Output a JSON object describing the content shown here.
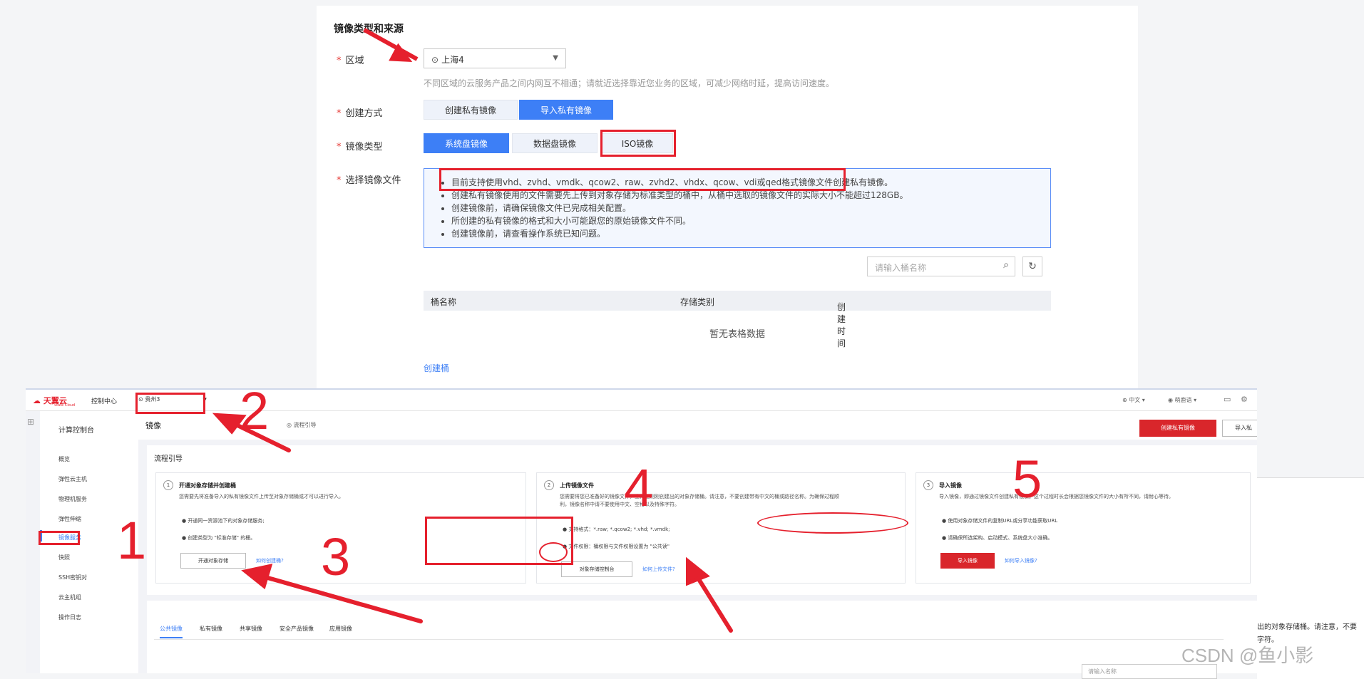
{
  "form": {
    "section_title": "镜像类型和来源",
    "region_label": "区域",
    "region_value": "上海4",
    "region_hint": "不同区域的云服务产品之间内网互不相通；请就近选择靠近您业务的区域，可减少网络时延，提高访问速度。",
    "create_method_label": "创建方式",
    "create_method_options": [
      "创建私有镜像",
      "导入私有镜像"
    ],
    "create_method_selected": "导入私有镜像",
    "image_type_label": "镜像类型",
    "image_type_options": [
      "系统盘镜像",
      "数据盘镜像",
      "ISO镜像"
    ],
    "image_type_selected": "系统盘镜像",
    "file_label": "选择镜像文件",
    "notes": [
      "目前支持使用vhd、zvhd、vmdk、qcow2、raw、zvhd2、vhdx、qcow、vdi或qed格式镜像文件创建私有镜像。",
      "创建私有镜像使用的文件需要先上传到对象存储为标准类型的桶中，从桶中选取的镜像文件的实际大小不能超过128GB。",
      "创建镜像前，请确保镜像文件已完成相关配置。",
      "所创建的私有镜像的格式和大小可能跟您的原始镜像文件不同。",
      "创建镜像前，请查看操作系统已知问题。"
    ],
    "bucket_search_placeholder": "请输入桶名称",
    "table_columns": [
      "桶名称",
      "存储类别",
      "创建时间"
    ],
    "table_empty": "暂无表格数据",
    "create_bucket_link": "创建桶"
  },
  "console": {
    "logo": "天翼云",
    "logo_sub": "State Cloud",
    "control_center": "控制中心",
    "region": "贵州3",
    "language": "中文",
    "user": "萌鹿语",
    "sidebar_head": "计算控制台",
    "sidebar_items": [
      "概览",
      "弹性云主机",
      "物理机服务",
      "弹性伸缩",
      "镜像服务",
      "快照",
      "SSH密钥对",
      "云主机组",
      "操作日志"
    ],
    "sidebar_active": "镜像服务",
    "page_title": "镜像",
    "guide_link": "流程引导",
    "btn_create_private": "创建私有镜像",
    "btn_import": "导入私",
    "flow_title": "流程引导",
    "cards": [
      {
        "num": "1",
        "title": "开通对象存储并创建桶",
        "desc": "您需要先将准备导入的私有镜像文件上传至对象存储桶或才可以进行导入。",
        "bullets": [
          "开通同一资源池下的对象存储服务;",
          "创建类型为 \"标准存储\" 的桶。"
        ],
        "button": "开通对象存储",
        "link": "如何创建桶?"
      },
      {
        "num": "2",
        "title": "上传镜像文件",
        "desc": "您需要将您已准备好的镜像文件，上传至刚刚创建出的对象存储桶。请注意，不要创建带有中文的桶或路径名称。为确保过程顺利，镜像名称中请不要使用中文、空格以及特殊字符。",
        "bullets": [
          "支持格式：*.raw; *.qcow2; *.vhd; *.vmdk;",
          "文件权限：桶权限与文件权限设置为 \"公共读\""
        ],
        "button": "对象存储控制台",
        "link": "如何上传文件?"
      },
      {
        "num": "3",
        "title": "导入镜像",
        "desc": "导入镜像，即通过镜像文件创建私有镜像。这个过程时长会根据您镜像文件的大小有所不同，请耐心等待。",
        "bullets": [
          "使用对象存储文件的复制URL或分享功能获取URL",
          "请确保所选架构、启动模式、系统盘大小准确。"
        ],
        "button": "导入镜像",
        "link": "如何导入镜像?"
      }
    ],
    "tabs": [
      "公共镜像",
      "私有镜像",
      "共享镜像",
      "安全产品镜像",
      "应用镜像"
    ],
    "tab_active": "公共镜像",
    "search_placeholder": "请输入名称"
  },
  "annotations": [
    "1",
    "2",
    "3",
    "4",
    "5"
  ],
  "residue": {
    "line1": "出的对象存储桶。请注意，不要",
    "line2": "字符。"
  },
  "watermark": "CSDN @鱼小影"
}
